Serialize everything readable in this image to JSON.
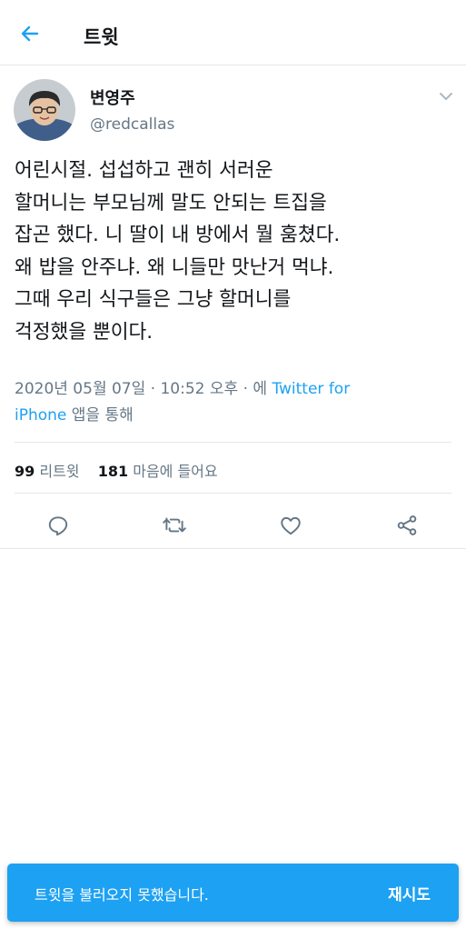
{
  "header": {
    "back_icon": "arrow-left-icon",
    "title": "트윗"
  },
  "tweet": {
    "author_name": "변영주",
    "author_handle": "@redcallas",
    "text_lines": [
      "어린시절. 섭섭하고 괜히 서러운",
      "할머니는 부모님께 말도 안되는 트집을",
      "잡곤 했다. 니 딸이 내 방에서 뭘 훔쳤다.",
      "왜 밥을 안주냐. 왜 니들만 맛난거 먹냐.",
      "그때 우리 식구들은 그냥 할머니를",
      "걱정했을 뿐이다."
    ],
    "date": "2020년 05월 07일",
    "separator": "·",
    "time": "10:52 오후",
    "via_prefix": "에",
    "client_part1": "Twitter for",
    "client_part2": "iPhone",
    "via_suffix": "앱을 통해"
  },
  "stats": {
    "retweets_count": "99",
    "retweets_label": "리트윗",
    "likes_count": "181",
    "likes_label": "마음에 들어요"
  },
  "actions": [
    "reply-icon",
    "retweet-icon",
    "like-icon",
    "share-icon"
  ],
  "toast": {
    "message": "트윗을 불러오지 못했습니다.",
    "retry_label": "재시도"
  },
  "colors": {
    "accent": "#1da1f2",
    "text": "#14171a",
    "secondary": "#657786",
    "border": "#e1e8ed"
  }
}
